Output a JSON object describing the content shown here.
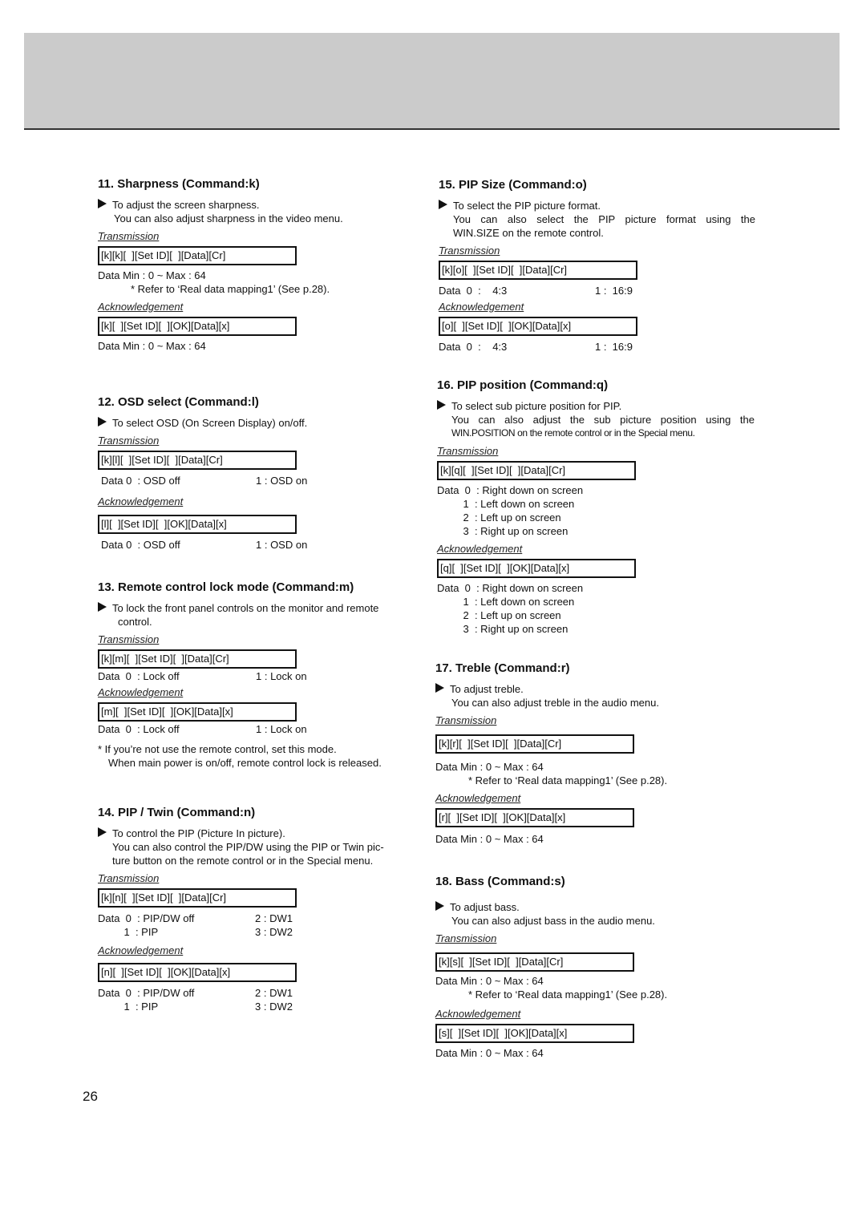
{
  "page_number": "26",
  "sections": {
    "s11": {
      "title": "11. Sharpness (Command:k)",
      "desc": [
        "To adjust the screen sharpness.",
        "You can also adjust sharpness in the video menu."
      ],
      "tx_label": "Transmission",
      "tx": "[k][k][  ][Set ID][  ][Data][Cr]",
      "tx_data": "Data   Min : 0 ~ Max : 64",
      "tx_note": "* Refer to ‘Real data mapping1’ (See p.28).",
      "ack_label": "Acknowledgement",
      "ack": "[k][  ][Set ID][  ][OK][Data][x]",
      "ack_data": "Data   Min : 0 ~ Max : 64"
    },
    "s12": {
      "title": "12. OSD select (Command:l)",
      "desc": [
        "To select OSD (On Screen Display) on/off."
      ],
      "tx_label": "Transmission",
      "tx": "[k][l][  ][Set ID][  ][Data][Cr]",
      "tx_data": {
        "a": "Data 0  : OSD off",
        "b": "1 : OSD on"
      },
      "ack_label": "Acknowledgement",
      "ack": "[l][  ][Set ID][  ][OK][Data][x]",
      "ack_data": {
        "a": "Data 0  : OSD off",
        "b": "1 : OSD on"
      }
    },
    "s13": {
      "title": "13. Remote control lock mode (Command:m)",
      "desc": [
        "To lock the front panel controls on the monitor and remote",
        "control."
      ],
      "tx_label": "Transmission",
      "tx": "[k][m][  ][Set ID][  ][Data][Cr]",
      "tx_data": {
        "a": "Data  0  : Lock off",
        "b": "1 : Lock on"
      },
      "ack_label": "Acknowledgement",
      "ack": "[m][  ][Set ID][  ][OK][Data][x]",
      "ack_data": {
        "a": "Data  0  : Lock off",
        "b": "1 : Lock on"
      },
      "notes": [
        "* If you’re not use the remote control, set this mode.",
        "When main power is on/off, remote control lock is released."
      ]
    },
    "s14": {
      "title": "14. PIP / Twin (Command:n)",
      "desc": [
        "To control the PIP (Picture In picture).",
        "You can also control the PIP/DW using the PIP or Twin pic-",
        "ture button on the remote control or in the Special menu."
      ],
      "tx_label": "Transmission",
      "tx": "[k][n][  ][Set ID][  ][Data][Cr]",
      "tx_rows": [
        {
          "a": "Data  0  : PIP/DW off",
          "b": "2 : DW1"
        },
        {
          "a": "         1  : PIP",
          "b": "3 : DW2"
        }
      ],
      "ack_label": "Acknowledgement",
      "ack": "[n][  ][Set ID][  ][OK][Data][x]",
      "ack_rows": [
        {
          "a": "Data  0  : PIP/DW off",
          "b": "2 : DW1"
        },
        {
          "a": "         1  : PIP",
          "b": "3 : DW2"
        }
      ]
    },
    "s15": {
      "title": "15. PIP Size (Command:o)",
      "desc": [
        "To select the PIP picture format.",
        "You can also select the PIP picture format using the",
        "WIN.SIZE on the remote control."
      ],
      "tx_label": "Transmission",
      "tx": "[k][o][  ][Set ID][  ][Data][Cr]",
      "tx_data": {
        "a": "Data  0  :    4:3",
        "b": "1 :  16:9"
      },
      "ack_label": "Acknowledgement",
      "ack": "[o][  ][Set ID][  ][OK][Data][x]",
      "ack_data": {
        "a": "Data  0  :    4:3",
        "b": "1 :  16:9"
      }
    },
    "s16": {
      "title": "16. PIP position (Command:q)",
      "desc": [
        "To select sub picture position for PIP.",
        "You can also adjust the sub picture position using the",
        "WIN.POSITION on the remote control or in the Special menu."
      ],
      "tx_label": "Transmission",
      "tx": "[k][q][  ][Set ID][  ][Data][Cr]",
      "tx_rows": [
        "Data  0  : Right down on screen",
        "         1  : Left down on screen",
        "         2  : Left up on screen",
        "         3  : Right up on screen"
      ],
      "ack_label": "Acknowledgement",
      "ack": "[q][  ][Set ID][  ][OK][Data][x]",
      "ack_rows": [
        "Data  0  : Right down on screen",
        "         1  : Left down on screen",
        "         2  : Left up on screen",
        "         3  : Right up on screen"
      ]
    },
    "s17": {
      "title": "17. Treble (Command:r)",
      "desc": [
        "To adjust treble.",
        "You can also adjust treble in the audio menu."
      ],
      "tx_label": "Transmission",
      "tx": "[k][r][  ][Set ID][  ][Data][Cr]",
      "tx_data": "Data   Min : 0 ~ Max : 64",
      "tx_note": "* Refer to ‘Real data mapping1’ (See p.28).",
      "ack_label": "Acknowledgement",
      "ack": "[r][  ][Set ID][  ][OK][Data][x]",
      "ack_data": "Data   Min : 0 ~ Max : 64"
    },
    "s18": {
      "title": "18. Bass (Command:s)",
      "desc": [
        "To adjust bass.",
        "You can also adjust bass in the audio menu."
      ],
      "tx_label": "Transmission",
      "tx": "[k][s][  ][Set ID][  ][Data][Cr]",
      "tx_data": "Data   Min : 0 ~ Max : 64",
      "tx_note": "* Refer to ‘Real data mapping1’ (See p.28).",
      "ack_label": "Acknowledgement",
      "ack": "[s][  ][Set ID][  ][OK][Data][x]",
      "ack_data": "Data   Min : 0 ~ Max : 64"
    }
  }
}
